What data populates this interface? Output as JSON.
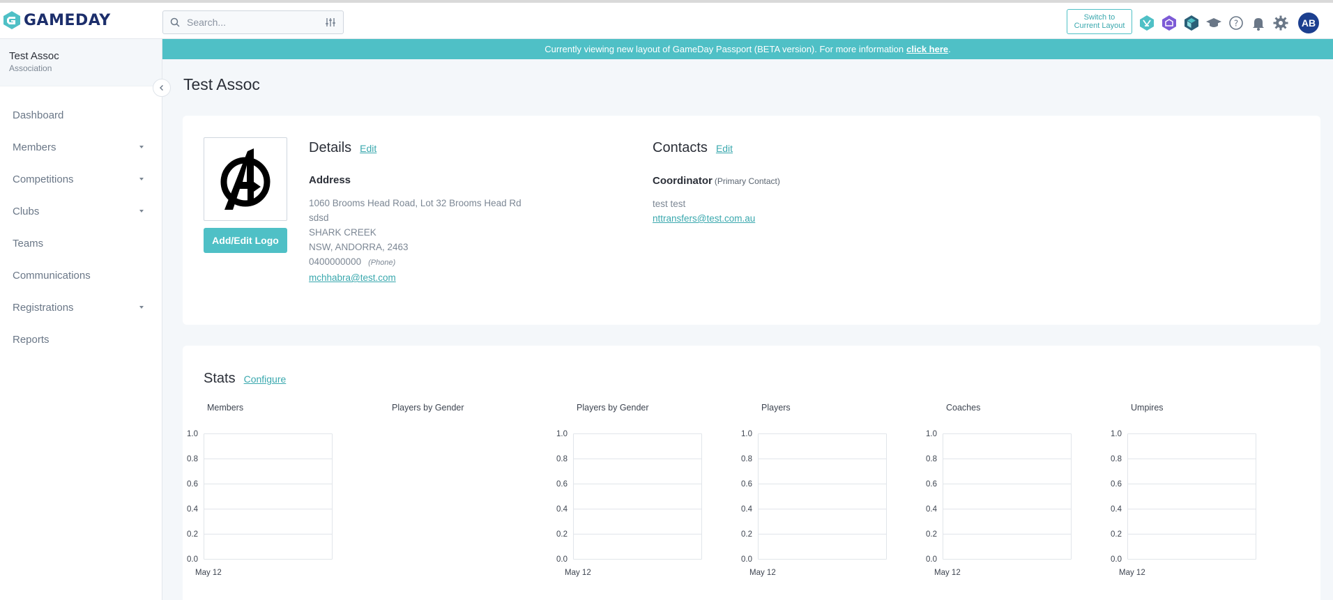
{
  "brand": {
    "name": "GAMEDAY",
    "accent": "#4fc0c6",
    "navy": "#1c2e6b"
  },
  "search": {
    "placeholder": "Search..."
  },
  "header": {
    "switch_line1": "Switch to",
    "switch_line2": "Current Layout",
    "avatar": "AB",
    "icons": [
      "app-hexagon-icon",
      "shield-app-icon",
      "cube-app-icon",
      "graduation-cap-icon",
      "help-icon",
      "bell-icon",
      "gear-icon"
    ]
  },
  "org": {
    "name": "Test Assoc",
    "type": "Association"
  },
  "nav": [
    {
      "label": "Dashboard",
      "dropdown": false
    },
    {
      "label": "Members",
      "dropdown": true
    },
    {
      "label": "Competitions",
      "dropdown": true
    },
    {
      "label": "Clubs",
      "dropdown": true
    },
    {
      "label": "Teams",
      "dropdown": false
    },
    {
      "label": "Communications",
      "dropdown": false
    },
    {
      "label": "Registrations",
      "dropdown": true
    },
    {
      "label": "Reports",
      "dropdown": false
    }
  ],
  "banner": {
    "text": "Currently viewing new layout of GameDay Passport (BETA version). For more information",
    "link": "click here",
    "suffix": "."
  },
  "page": {
    "title": "Test Assoc"
  },
  "logo_card": {
    "button": "Add/Edit Logo"
  },
  "details": {
    "title": "Details",
    "edit": "Edit",
    "address_heading": "Address",
    "line1": "1060 Brooms Head Road, Lot 32 Brooms Head Rd",
    "line2": "sdsd",
    "line3": "SHARK CREEK",
    "line4": "NSW,  ANDORRA,  2463",
    "phone": "0400000000",
    "phone_label": "(Phone)",
    "email": "mchhabra@test.com"
  },
  "contacts": {
    "title": "Contacts",
    "edit": "Edit",
    "role": "Coordinator",
    "role_note": "(Primary Contact)",
    "name": "test test",
    "email": "nttransfers@test.com.au"
  },
  "stats": {
    "title": "Stats",
    "configure": "Configure"
  },
  "chart_data": [
    {
      "type": "bar",
      "title": "Members",
      "categories": [
        "May 12"
      ],
      "values": [],
      "ylim": [
        0,
        1.0
      ],
      "yticks": [
        "0.0",
        "0.2",
        "0.4",
        "0.6",
        "0.8",
        "1.0"
      ],
      "grid": true
    },
    {
      "type": "pie",
      "title": "Players by Gender",
      "categories": [],
      "values": []
    },
    {
      "type": "bar",
      "title": "Players by Gender",
      "categories": [
        "May 12"
      ],
      "values": [],
      "ylim": [
        0,
        1.0
      ],
      "yticks": [
        "0.0",
        "0.2",
        "0.4",
        "0.6",
        "0.8",
        "1.0"
      ],
      "grid": true
    },
    {
      "type": "bar",
      "title": "Players",
      "categories": [
        "May 12"
      ],
      "values": [],
      "ylim": [
        0,
        1.0
      ],
      "yticks": [
        "0.0",
        "0.2",
        "0.4",
        "0.6",
        "0.8",
        "1.0"
      ],
      "grid": true
    },
    {
      "type": "bar",
      "title": "Coaches",
      "categories": [
        "May 12"
      ],
      "values": [],
      "ylim": [
        0,
        1.0
      ],
      "yticks": [
        "0.0",
        "0.2",
        "0.4",
        "0.6",
        "0.8",
        "1.0"
      ],
      "grid": true
    },
    {
      "type": "bar",
      "title": "Umpires",
      "categories": [
        "May 12"
      ],
      "values": [],
      "ylim": [
        0,
        1.0
      ],
      "yticks": [
        "0.0",
        "0.2",
        "0.4",
        "0.6",
        "0.8",
        "1.0"
      ],
      "grid": true
    }
  ]
}
